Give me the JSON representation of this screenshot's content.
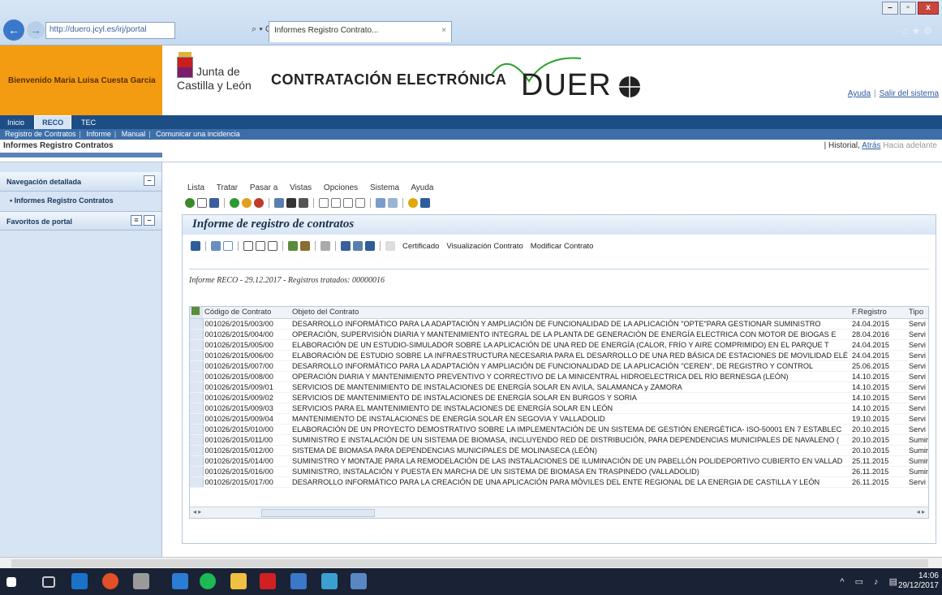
{
  "browser": {
    "url": "http://duero.jcyl.es/irj/portal",
    "tab_title": "Informes Registro Contrato...",
    "tab_close": "×",
    "addr_controls": "⌕ ▾ C"
  },
  "header": {
    "welcome": "Bienvenido Maria Luisa Cuesta Garcia",
    "org_line1": "Junta de",
    "org_line2": "Castilla y León",
    "title": "CONTRATACIÓN ELECTRÓNICA",
    "logo_text": "DUER",
    "help": "Ayuda",
    "logout": "Salir del sistema"
  },
  "topnav": [
    "Inicio",
    "RECO",
    "TEC"
  ],
  "subnav": [
    "Registro de Contratos",
    "Informe",
    "Manual",
    "Comunicar una incidencia"
  ],
  "pagebar": {
    "title": "Informes Registro Contratos",
    "history": "Historial",
    "back": "Atrás",
    "forward": "Hacia adelante"
  },
  "sidebar": {
    "nav_title": "Navegación detallada",
    "item": "• Informes Registro Contratos",
    "favorites": "Favoritos de portal"
  },
  "menu": [
    "Lista",
    "Tratar",
    "Pasar a",
    "Vistas",
    "Opciones",
    "Sistema",
    "Ayuda"
  ],
  "panel": {
    "title": "Informe de registro de contratos",
    "certificado": "Certificado",
    "visualizacion": "Visualización Contrato",
    "modificar": "Modificar Contrato",
    "info": "Informe RECO - 29.12.2017 - Registros tratados: 00000016"
  },
  "table": {
    "headers": [
      "Código de Contrato",
      "Objeto del Contrato",
      "F.Registro",
      "Tipo"
    ],
    "rows": [
      [
        "001026/2015/003/00",
        "DESARROLLO INFORMÁTICO PARA LA ADAPTACIÓN Y AMPLIACIÓN DE FUNCIONALIDAD DE LA APLICACIÓN \"OPTE\"PARA GESTIONAR SUMINISTRO",
        "24.04.2015",
        "Servi"
      ],
      [
        "001026/2015/004/00",
        "OPERACIÓN, SUPERVISIÓN DIARIA Y MANTENIMIENTO INTEGRAL DE LA PLANTA DE GENERACIÓN DE ENERGÍA ELECTRICA CON MOTOR DE BIOGAS E",
        "28.04.2016",
        "Servi"
      ],
      [
        "001026/2015/005/00",
        "ELABORACIÓN DE UN ESTUDIO-SIMULADOR SOBRE LA APLICACIÓN DE UNA RED DE ENERGÍA (CALOR, FRÍO Y AIRE COMPRIMIDO) EN EL PARQUE T",
        "24.04.2015",
        "Servi"
      ],
      [
        "001026/2015/006/00",
        "ELABORACIÓN DE ESTUDIO SOBRE LA INFRAESTRUCTURA NECESARIA PARA EL DESARROLLO DE UNA RED BÁSICA DE ESTACIONES DE MOVILIDAD ELÉ",
        "24.04.2015",
        "Servi"
      ],
      [
        "001026/2015/007/00",
        "DESARROLLO INFORMÁTICO PARA LA ADAPTACIÓN Y AMPLIACIÓN DE FUNCIONALIDAD DE LA APLICACIÓN \"CEREN\", DE REGISTRO Y CONTROL",
        "25.06.2015",
        "Servi"
      ],
      [
        "001026/2015/008/00",
        "OPERACIÓN DIARIA Y MANTENIMIENTO PREVENTIVO Y CORRECTIVO DE LA MINICENTRAL HIDROELECTRICA DEL RÍO BERNESGA (LEÓN)",
        "14.10.2015",
        "Servi"
      ],
      [
        "001026/2015/009/01",
        "SERVICIOS DE MANTENIMIENTO DE INSTALACIONES DE ENERGÍA SOLAR EN AVILA, SALAMANCA y ZAMORA",
        "14.10.2015",
        "Servi"
      ],
      [
        "001026/2015/009/02",
        "SERVICIOS DE MANTENIMIENTO DE INSTALACIONES DE ENERGÍA SOLAR EN BURGOS Y SORIA",
        "14.10.2015",
        "Servi"
      ],
      [
        "001026/2015/009/03",
        "SERVICIOS PARA EL MANTENIMIENTO DE INSTALACIONES DE ENERGÍA SOLAR EN LEÓN",
        "14.10.2015",
        "Servi"
      ],
      [
        "001026/2015/009/04",
        "MANTENIMIENTO DE INSTALACIONES DE ENERGÍA SOLAR EN SEGOVIA Y VALLADOLID",
        "19.10.2015",
        "Servi"
      ],
      [
        "001026/2015/010/00",
        "ELABORACIÓN DE UN PROYECTO DEMOSTRATIVO SOBRE LA IMPLEMENTACIÓN DE UN SISTEMA DE GESTIÓN ENERGÉTICA- ISO-50001 EN 7 ESTABLEC",
        "20.10.2015",
        "Servi"
      ],
      [
        "001026/2015/011/00",
        "SUMINISTRO E INSTALACIÓN DE UN SISTEMA DE BIOMASA, INCLUYENDO RED DE DISTRIBUCIÓN, PARA DEPENDENCIAS MUNICIPALES DE NAVALENO (",
        "20.10.2015",
        "Sumir"
      ],
      [
        "001026/2015/012/00",
        "SISTEMA DE BIOMASA PARA DEPENDENCIAS MUNICIPALES DE MOLINASECA (LEÓN)",
        "20.10.2015",
        "Sumir"
      ],
      [
        "001026/2015/014/00",
        "SUMINISTRO Y MONTAJE PARA LA REMODELACIÓN DE LAS INSTALACIONES DE ILUMINACIÓN DE UN PABELLÓN POLIDEPORTIVO CUBIERTO EN VALLAD",
        "25.11.2015",
        "Sumir"
      ],
      [
        "001026/2015/016/00",
        "SUMINISTRO, INSTALACIÓN Y PUESTA EN MARCHA DE UN SISTEMA DE BIOMASA EN TRASPINEDO (VALLADOLID)",
        "26.11.2015",
        "Sumir"
      ],
      [
        "001026/2015/017/00",
        "DESARROLLO INFORMÁTICO PARA LA CREACIÓN DE UNA APLICACIÓN PARA MÓVILES DEL ENTE REGIONAL DE LA ENERGIA DE CASTILLA Y LEÓN",
        "26.11.2015",
        "Servi"
      ]
    ]
  },
  "taskbar": {
    "time": "14:06",
    "date": "29/12/2017"
  },
  "colors": {
    "welcome_bg": "#f39c12",
    "nav_bg": "#1c4d85",
    "sidebar_bg": "#d6e4f3"
  }
}
